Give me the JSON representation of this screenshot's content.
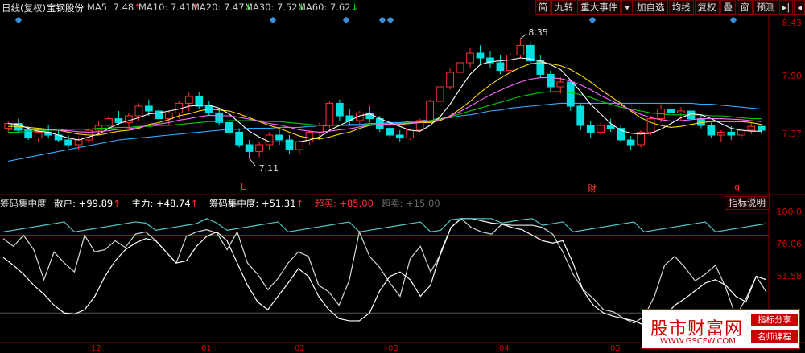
{
  "header": {
    "period": "日线(复权)",
    "stock": "宝钢股份",
    "ma": [
      {
        "label": "MA5: 7.48",
        "arrow": "↑",
        "color": "#ffffff"
      },
      {
        "label": "MA10: 7.41",
        "arrow": "↑",
        "color": "#ffd700"
      },
      {
        "label": "MA20: 7.47",
        "arrow": "↓",
        "color": "#ff66ff"
      },
      {
        "label": "MA30: 7.52",
        "arrow": "↓",
        "color": "#00dd00"
      },
      {
        "label": "MA60: 7.62",
        "arrow": "↓",
        "color": "#33aaff"
      }
    ]
  },
  "toolbar": [
    "简",
    "九转",
    "重大事件",
    "▾",
    "加自选",
    "均线",
    "复权",
    "叠",
    "窗",
    "预测",
    "▸|",
    "◂"
  ],
  "price_axis": [
    "8.43",
    "7.90",
    "7.37"
  ],
  "annotations": {
    "high": "8.35",
    "low": "7.11",
    "event_l": "L",
    "event_cai": "财",
    "event_q": "q"
  },
  "panel2": {
    "name": "筹码集中度",
    "retail": "散户: +99.89",
    "main": "主力: +48.74",
    "conc": "筹码集中度: +51.31",
    "overbuy": "超买: +85.00",
    "oversell": "超卖: +15.00",
    "explain": "指标说明",
    "axis": [
      "100.0",
      "76.06",
      "51.58"
    ]
  },
  "x_axis": [
    "12",
    "01",
    "02",
    "03",
    "04",
    "05"
  ],
  "watermark": {
    "title": "股市财富网",
    "url": "WWW.GSCFW.COM",
    "tag1": "指标分享",
    "tag2": "名师课程"
  },
  "colors": {
    "up": "#ff3030",
    "down": "#00e0e0",
    "retail": "#ffffff",
    "main": "#55c8c8"
  },
  "chart_data": {
    "type": "candlestick",
    "ylim": [
      7.0,
      8.5
    ],
    "candles": [
      [
        7.42,
        7.5,
        7.38,
        7.47
      ],
      [
        7.47,
        7.52,
        7.38,
        7.4
      ],
      [
        7.4,
        7.44,
        7.3,
        7.32
      ],
      [
        7.32,
        7.4,
        7.28,
        7.38
      ],
      [
        7.38,
        7.45,
        7.32,
        7.35
      ],
      [
        7.35,
        7.4,
        7.28,
        7.3
      ],
      [
        7.3,
        7.35,
        7.22,
        7.25
      ],
      [
        7.25,
        7.33,
        7.2,
        7.3
      ],
      [
        7.3,
        7.42,
        7.27,
        7.4
      ],
      [
        7.4,
        7.5,
        7.35,
        7.45
      ],
      [
        7.45,
        7.55,
        7.4,
        7.52
      ],
      [
        7.52,
        7.6,
        7.45,
        7.48
      ],
      [
        7.48,
        7.58,
        7.42,
        7.55
      ],
      [
        7.55,
        7.68,
        7.5,
        7.65
      ],
      [
        7.65,
        7.72,
        7.55,
        7.6
      ],
      [
        7.6,
        7.64,
        7.5,
        7.52
      ],
      [
        7.52,
        7.6,
        7.45,
        7.58
      ],
      [
        7.58,
        7.7,
        7.52,
        7.68
      ],
      [
        7.68,
        7.8,
        7.6,
        7.75
      ],
      [
        7.75,
        7.8,
        7.62,
        7.65
      ],
      [
        7.65,
        7.7,
        7.55,
        7.58
      ],
      [
        7.58,
        7.62,
        7.45,
        7.48
      ],
      [
        7.48,
        7.52,
        7.35,
        7.38
      ],
      [
        7.38,
        7.42,
        7.22,
        7.25
      ],
      [
        7.25,
        7.3,
        7.11,
        7.18
      ],
      [
        7.18,
        7.28,
        7.12,
        7.25
      ],
      [
        7.25,
        7.38,
        7.2,
        7.35
      ],
      [
        7.35,
        7.42,
        7.25,
        7.3
      ],
      [
        7.3,
        7.35,
        7.15,
        7.2
      ],
      [
        7.2,
        7.3,
        7.15,
        7.28
      ],
      [
        7.28,
        7.4,
        7.25,
        7.38
      ],
      [
        7.38,
        7.48,
        7.3,
        7.45
      ],
      [
        7.45,
        7.7,
        7.42,
        7.68
      ],
      [
        7.68,
        7.72,
        7.5,
        7.55
      ],
      [
        7.55,
        7.62,
        7.45,
        7.5
      ],
      [
        7.5,
        7.6,
        7.45,
        7.58
      ],
      [
        7.58,
        7.65,
        7.48,
        7.52
      ],
      [
        7.52,
        7.55,
        7.38,
        7.42
      ],
      [
        7.42,
        7.48,
        7.32,
        7.35
      ],
      [
        7.35,
        7.4,
        7.28,
        7.32
      ],
      [
        7.32,
        7.42,
        7.3,
        7.4
      ],
      [
        7.4,
        7.52,
        7.38,
        7.5
      ],
      [
        7.5,
        7.72,
        7.48,
        7.7
      ],
      [
        7.7,
        7.88,
        7.68,
        7.85
      ],
      [
        7.85,
        8.05,
        7.82,
        8.0
      ],
      [
        8.0,
        8.15,
        7.95,
        8.1
      ],
      [
        8.1,
        8.25,
        8.05,
        8.2
      ],
      [
        8.2,
        8.28,
        8.08,
        8.15
      ],
      [
        8.15,
        8.22,
        8.05,
        8.1
      ],
      [
        8.1,
        8.18,
        7.98,
        8.02
      ],
      [
        8.02,
        8.2,
        8.0,
        8.18
      ],
      [
        8.18,
        8.35,
        8.15,
        8.28
      ],
      [
        8.28,
        8.32,
        8.1,
        8.12
      ],
      [
        8.12,
        8.18,
        7.95,
        7.98
      ],
      [
        7.98,
        8.02,
        7.8,
        7.85
      ],
      [
        7.85,
        7.95,
        7.78,
        7.9
      ],
      [
        7.9,
        7.92,
        7.6,
        7.65
      ],
      [
        7.65,
        7.68,
        7.4,
        7.45
      ],
      [
        7.45,
        7.5,
        7.32,
        7.38
      ],
      [
        7.38,
        7.48,
        7.35,
        7.45
      ],
      [
        7.45,
        7.52,
        7.38,
        7.42
      ],
      [
        7.42,
        7.46,
        7.28,
        7.3
      ],
      [
        7.3,
        7.34,
        7.2,
        7.25
      ],
      [
        7.25,
        7.4,
        7.22,
        7.38
      ],
      [
        7.38,
        7.55,
        7.35,
        7.52
      ],
      [
        7.52,
        7.66,
        7.48,
        7.62
      ],
      [
        7.62,
        7.68,
        7.52,
        7.58
      ],
      [
        7.58,
        7.64,
        7.5,
        7.6
      ],
      [
        7.6,
        7.65,
        7.48,
        7.52
      ],
      [
        7.52,
        7.56,
        7.42,
        7.45
      ],
      [
        7.45,
        7.48,
        7.32,
        7.35
      ],
      [
        7.35,
        7.4,
        7.28,
        7.38
      ],
      [
        7.38,
        7.44,
        7.3,
        7.35
      ],
      [
        7.35,
        7.42,
        7.3,
        7.4
      ],
      [
        7.4,
        7.48,
        7.36,
        7.44
      ],
      [
        7.44,
        7.46,
        7.36,
        7.4
      ]
    ],
    "ma5": [
      7.47,
      7.46,
      7.42,
      7.39,
      7.38,
      7.35,
      7.32,
      7.3,
      7.33,
      7.36,
      7.42,
      7.47,
      7.5,
      7.53,
      7.57,
      7.58,
      7.6,
      7.62,
      7.65,
      7.66,
      7.66,
      7.63,
      7.57,
      7.48,
      7.39,
      7.33,
      7.28,
      7.28,
      7.28,
      7.28,
      7.3,
      7.33,
      7.4,
      7.45,
      7.5,
      7.55,
      7.57,
      7.52,
      7.48,
      7.44,
      7.4,
      7.39,
      7.45,
      7.54,
      7.67,
      7.83,
      7.98,
      8.08,
      8.11,
      8.12,
      8.13,
      8.15,
      8.14,
      8.12,
      8.08,
      8.03,
      7.92,
      7.8,
      7.67,
      7.57,
      7.47,
      7.4,
      7.37,
      7.36,
      7.37,
      7.41,
      7.47,
      7.53,
      7.57,
      7.56,
      7.52,
      7.47,
      7.42,
      7.4,
      7.39,
      7.39
    ],
    "ma10": [
      7.44,
      7.44,
      7.43,
      7.42,
      7.41,
      7.4,
      7.38,
      7.36,
      7.35,
      7.35,
      7.37,
      7.39,
      7.4,
      7.42,
      7.46,
      7.48,
      7.51,
      7.55,
      7.57,
      7.6,
      7.62,
      7.61,
      7.6,
      7.57,
      7.53,
      7.49,
      7.45,
      7.42,
      7.38,
      7.34,
      7.32,
      7.31,
      7.33,
      7.36,
      7.38,
      7.42,
      7.45,
      7.46,
      7.46,
      7.46,
      7.47,
      7.48,
      7.48,
      7.5,
      7.55,
      7.62,
      7.7,
      7.79,
      7.87,
      7.94,
      8.0,
      8.05,
      8.09,
      8.1,
      8.09,
      8.07,
      8.03,
      7.97,
      7.9,
      7.82,
      7.75,
      7.68,
      7.6,
      7.53,
      7.48,
      7.45,
      7.43,
      7.44,
      7.46,
      7.48,
      7.49,
      7.49,
      7.49,
      7.49,
      7.48,
      7.46
    ],
    "ma30": [
      7.38,
      7.38,
      7.39,
      7.39,
      7.4,
      7.4,
      7.41,
      7.41,
      7.41,
      7.42,
      7.42,
      7.43,
      7.43,
      7.44,
      7.44,
      7.45,
      7.45,
      7.46,
      7.47,
      7.48,
      7.49,
      7.49,
      7.5,
      7.5,
      7.5,
      7.5,
      7.49,
      7.49,
      7.48,
      7.47,
      7.46,
      7.45,
      7.45,
      7.45,
      7.45,
      7.45,
      7.46,
      7.46,
      7.47,
      7.47,
      7.48,
      7.49,
      7.5,
      7.52,
      7.54,
      7.57,
      7.6,
      7.63,
      7.66,
      7.69,
      7.72,
      7.75,
      7.77,
      7.79,
      7.8,
      7.8,
      7.79,
      7.77,
      7.74,
      7.7,
      7.67,
      7.64,
      7.62,
      7.6,
      7.58,
      7.57,
      7.56,
      7.56,
      7.56,
      7.56,
      7.55,
      7.55,
      7.54,
      7.53,
      7.52,
      7.52
    ],
    "ma60": [
      7.08,
      7.1,
      7.12,
      7.14,
      7.16,
      7.18,
      7.2,
      7.22,
      7.24,
      7.26,
      7.28,
      7.3,
      7.31,
      7.32,
      7.33,
      7.34,
      7.35,
      7.36,
      7.37,
      7.38,
      7.39,
      7.4,
      7.41,
      7.41,
      7.42,
      7.42,
      7.42,
      7.43,
      7.43,
      7.43,
      7.44,
      7.44,
      7.45,
      7.45,
      7.46,
      7.46,
      7.47,
      7.47,
      7.48,
      7.48,
      7.49,
      7.5,
      7.51,
      7.52,
      7.53,
      7.55,
      7.56,
      7.58,
      7.6,
      7.61,
      7.63,
      7.64,
      7.65,
      7.66,
      7.67,
      7.68,
      7.68,
      7.68,
      7.68,
      7.68,
      7.68,
      7.68,
      7.68,
      7.68,
      7.68,
      7.68,
      7.68,
      7.68,
      7.68,
      7.67,
      7.67,
      7.66,
      7.65,
      7.64,
      7.63,
      7.62
    ],
    "indicator": {
      "ylim": [
        0,
        110
      ],
      "retail": [
        65,
        58,
        50,
        40,
        32,
        22,
        15,
        14,
        18,
        30,
        48,
        62,
        72,
        78,
        82,
        80,
        70,
        60,
        62,
        75,
        84,
        88,
        80,
        60,
        40,
        25,
        18,
        30,
        42,
        55,
        48,
        30,
        18,
        10,
        8,
        8,
        15,
        35,
        48,
        52,
        45,
        30,
        40,
        70,
        92,
        100,
        100,
        98,
        96,
        95,
        92,
        90,
        85,
        80,
        78,
        80,
        60,
        35,
        22,
        15,
        12,
        10,
        8,
        4,
        4,
        12,
        22,
        28,
        35,
        42,
        45,
        40,
        30,
        25,
        48,
        45
      ],
      "main": [
        82,
        75,
        85,
        72,
        45,
        70,
        60,
        52,
        85,
        70,
        72,
        80,
        74,
        86,
        88,
        80,
        70,
        60,
        84,
        88,
        90,
        87,
        72,
        88,
        60,
        50,
        36,
        46,
        60,
        70,
        66,
        40,
        34,
        22,
        44,
        88,
        66,
        56,
        42,
        30,
        64,
        75,
        52,
        68,
        92,
        100,
        92,
        88,
        86,
        95,
        94,
        94,
        94,
        92,
        86,
        70,
        50,
        36,
        28,
        18,
        16,
        10,
        6,
        12,
        30,
        58,
        66,
        56,
        44,
        50,
        58,
        38,
        12,
        28,
        48,
        34
      ]
    }
  }
}
